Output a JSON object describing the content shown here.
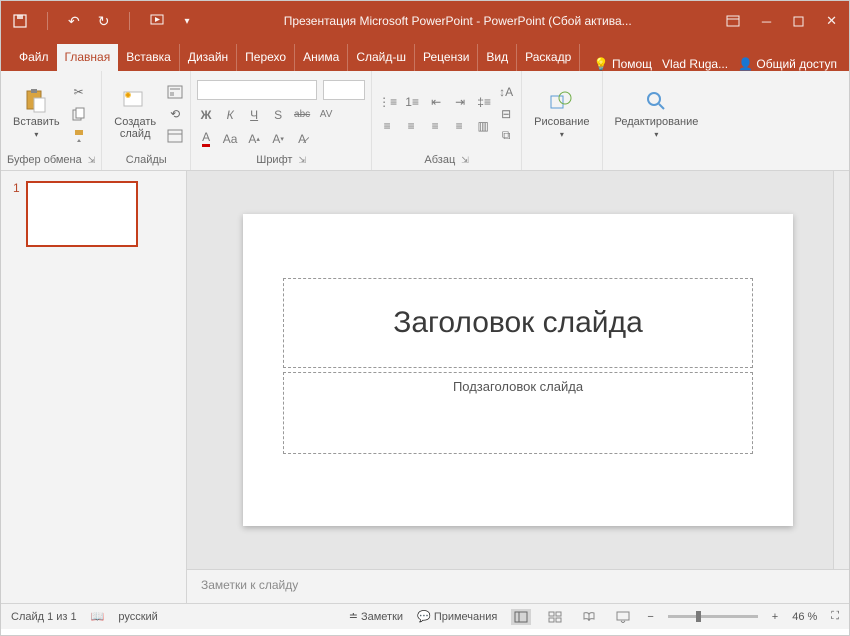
{
  "title": "Презентация Microsoft PowerPoint - PowerPoint (Сбой актива...",
  "tabs": {
    "file": "Файл",
    "home": "Главная",
    "insert": "Вставка",
    "design": "Дизайн",
    "transitions": "Перехо",
    "animations": "Анима",
    "slideshow": "Слайд-ш",
    "review": "Рецензи",
    "view": "Вид",
    "recording": "Раскадр"
  },
  "help": "Помощ",
  "user": "Vlad Ruga...",
  "share": "Общий доступ",
  "groups": {
    "clipboard": {
      "label": "Буфер обмена",
      "paste": "Вставить"
    },
    "slides": {
      "label": "Слайды",
      "new": "Создать\nслайд"
    },
    "font": {
      "label": "Шрифт"
    },
    "paragraph": {
      "label": "Абзац"
    },
    "drawing": {
      "label": "Рисование"
    },
    "editing": {
      "label": "Редактирование"
    }
  },
  "slide": {
    "title_placeholder": "Заголовок слайда",
    "subtitle_placeholder": "Подзаголовок слайда",
    "notes_placeholder": "Заметки к слайду"
  },
  "thumb": {
    "num": "1"
  },
  "status": {
    "slide_count": "Слайд 1 из 1",
    "language": "русский",
    "notes_btn": "Заметки",
    "comments_btn": "Примечания",
    "zoom": "46 %"
  },
  "font_buttons": {
    "bold": "Ж",
    "italic": "К",
    "underline": "Ч",
    "strike": "S",
    "abc": "abc",
    "av": "AV"
  }
}
